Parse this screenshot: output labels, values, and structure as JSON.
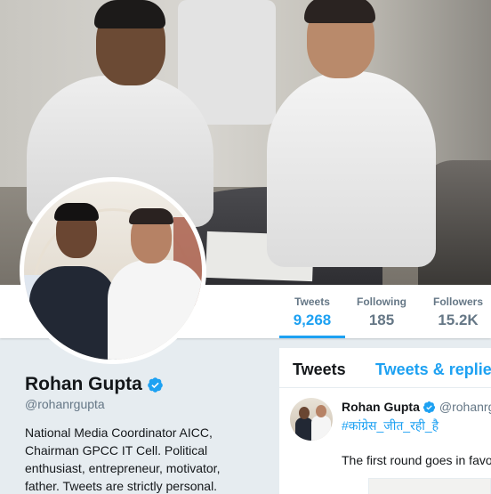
{
  "profile": {
    "name": "Rohan Gupta",
    "handle": "@rohanrgupta",
    "bio": "National Media Coordinator AICC, Chairman GPCC IT Cell. Political enthusiast, entrepreneur, motivator, father. Tweets are strictly personal.",
    "verified": true
  },
  "stats": [
    {
      "label": "Tweets",
      "value": "9,268",
      "active": true
    },
    {
      "label": "Following",
      "value": "185",
      "active": false
    },
    {
      "label": "Followers",
      "value": "15.2K",
      "active": false
    }
  ],
  "timeline": {
    "tabs": [
      {
        "label": "Tweets",
        "active": true
      },
      {
        "label": "Tweets & replies",
        "active": false
      }
    ],
    "tweet": {
      "name": "Rohan Gupta",
      "handle": "@rohanrg",
      "hashtag": "#कांग्रेस_जीत_रही_है",
      "text": "The first round goes in favo"
    }
  },
  "colors": {
    "accent": "#1da1f2",
    "text": "#14171a",
    "muted": "#657786",
    "background": "#e6ecf0"
  }
}
